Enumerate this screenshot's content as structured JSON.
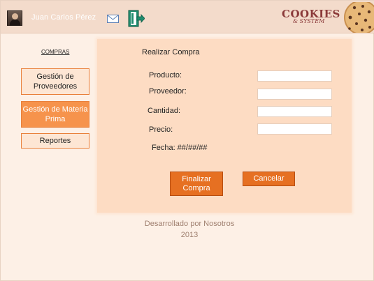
{
  "header": {
    "user_name": "Juan Carlos Pérez",
    "brand_title": "COOKIES",
    "brand_subtitle": "& SYSTEM",
    "icons": [
      "avatar",
      "mail-icon",
      "logout-icon",
      "cookie-image"
    ]
  },
  "sidebar": {
    "title": "COMPRAS",
    "items": [
      {
        "label": "Gestión de Proveedores",
        "active": false
      },
      {
        "label": "Gestión de Materia Prima",
        "active": true
      },
      {
        "label": "Reportes",
        "active": false
      }
    ]
  },
  "form": {
    "title": "Realizar Compra",
    "fields": [
      {
        "label": "Producto:",
        "value": ""
      },
      {
        "label": "Proveedor:",
        "value": ""
      },
      {
        "label": "Cantidad:",
        "value": ""
      },
      {
        "label": "Precio:",
        "value": ""
      }
    ],
    "date_text": "Fecha: ##/##/##",
    "finalize_label": "Finalizar Compra",
    "cancel_label": "Cancelar"
  },
  "footer": {
    "line1": "Desarrollado por Nosotros",
    "line2": "2013"
  },
  "colors": {
    "accent": "#e67022",
    "active_menu": "#f6934c",
    "panel": "#fddcc3",
    "header": "#f3dbcb",
    "brand": "#8b3a3a"
  }
}
